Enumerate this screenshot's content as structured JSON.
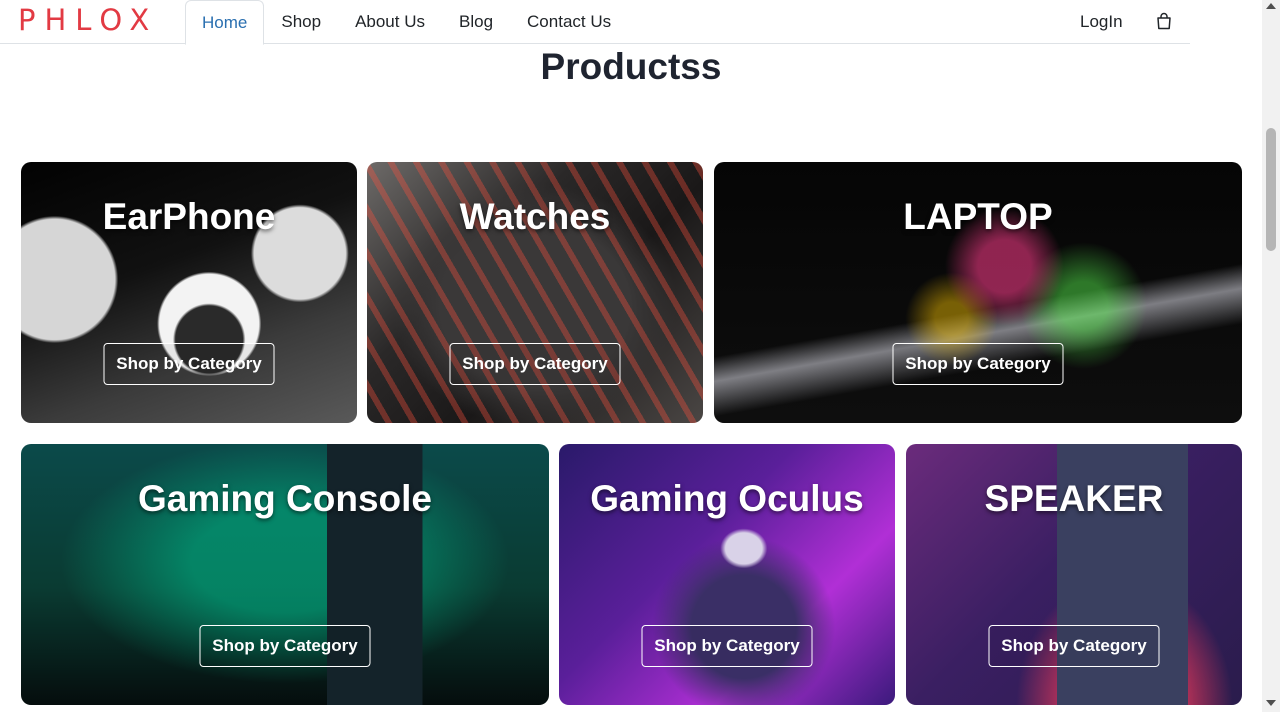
{
  "brand": {
    "logo_text": "PHLOX",
    "accent_color": "#e23a43"
  },
  "nav": {
    "items": [
      {
        "label": "Home",
        "active": true
      },
      {
        "label": "Shop",
        "active": false
      },
      {
        "label": "About Us",
        "active": false
      },
      {
        "label": "Blog",
        "active": false
      },
      {
        "label": "Contact Us",
        "active": false
      }
    ],
    "login_label": "LogIn",
    "cart_icon": "shopping-bag-icon"
  },
  "main": {
    "title": "Productss",
    "cards": [
      {
        "title": "EarPhone",
        "button_label": "Shop by Category"
      },
      {
        "title": "Watches",
        "button_label": "Shop by Category"
      },
      {
        "title": "LAPTOP",
        "button_label": "Shop by Category"
      },
      {
        "title": "Gaming Console",
        "button_label": "Shop by Category"
      },
      {
        "title": "Gaming Oculus",
        "button_label": "Shop by Category"
      },
      {
        "title": "SPEAKER",
        "button_label": "Shop by Category"
      }
    ]
  }
}
